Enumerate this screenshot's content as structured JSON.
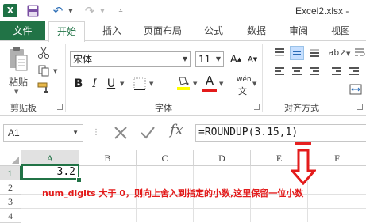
{
  "title_bar": {
    "app_logo": "X",
    "document_title": "Excel2.xlsx -"
  },
  "tabs": [
    {
      "label": "文件",
      "active": false
    },
    {
      "label": "开始",
      "active": true
    },
    {
      "label": "插入",
      "active": false
    },
    {
      "label": "页面布局",
      "active": false
    },
    {
      "label": "公式",
      "active": false
    },
    {
      "label": "数据",
      "active": false
    },
    {
      "label": "审阅",
      "active": false
    },
    {
      "label": "视图",
      "active": false
    }
  ],
  "ribbon": {
    "clipboard": {
      "paste_label": "粘贴",
      "group_label": "剪贴板"
    },
    "font": {
      "font_name": "宋体",
      "font_size": "11",
      "bold": "B",
      "italic": "I",
      "underline": "U",
      "font_color_glyph": "A",
      "phonetic": "wén",
      "group_label": "字体",
      "colors": {
        "highlight": "#ffff00",
        "font_color": "#e31b1b"
      }
    },
    "alignment": {
      "group_label": "对齐方式"
    }
  },
  "formula_bar": {
    "name_box": "A1",
    "fx_label": "fx",
    "formula": "=ROUNDUP(3.15,1)"
  },
  "sheet": {
    "columns": [
      "A",
      "B",
      "C",
      "D",
      "E",
      "F"
    ],
    "rows": [
      "1",
      "2",
      "3",
      "4"
    ],
    "active_cell_value": "3.2"
  },
  "annotation": "num_digits 大于 0，则向上舍入到指定的小数,这里保留一位小数",
  "colors": {
    "accent": "#217346",
    "annotation": "#e31b1b"
  }
}
